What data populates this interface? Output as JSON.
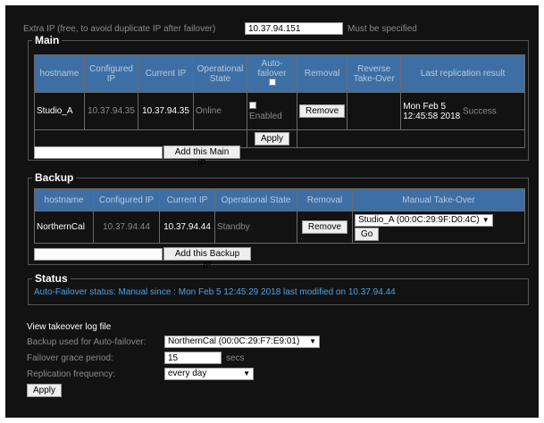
{
  "extra_ip": {
    "label": "Extra IP (free, to avoid duplicate IP after failover)",
    "value": "10.37.94.151",
    "note": "Must be specified"
  },
  "main": {
    "legend": "Main",
    "headers": [
      "hostname",
      "Configured IP",
      "Current IP",
      "Operational State",
      "Auto-failover",
      "Removal",
      "Reverse Take-Over",
      "Last replication result"
    ],
    "row": {
      "hostname": "Studio_A",
      "configured_ip": "10.37.94.35",
      "current_ip": "10.37.94.35",
      "state": "Online",
      "auto_failover": "Enabled",
      "remove_label": "Remove",
      "last_date": "Mon Feb 5",
      "last_time": "12:45:58 2018",
      "last_result": "Success"
    },
    "apply_label": "Apply",
    "add_label": "Add this Main IP",
    "add_value": ""
  },
  "backup": {
    "legend": "Backup",
    "headers": [
      "hostname",
      "Configured IP",
      "Current IP",
      "Operational State",
      "Removal",
      "Manual Take-Over"
    ],
    "row": {
      "hostname": "NorthernCal",
      "configured_ip": "10.37.94.44",
      "current_ip": "10.37.94.44",
      "state": "Standby",
      "remove_label": "Remove",
      "takeover_select": "Studio_A (00:0C:29:9F:D0:4C)",
      "go_label": "Go"
    },
    "add_label": "Add this Backup IP",
    "add_value": ""
  },
  "status": {
    "legend": "Status",
    "text": "Auto-Failover status: Manual since : Mon Feb 5 12:45:29 2018 last modified on 10.37.94.44"
  },
  "settings": {
    "log_link": "View takeover log file",
    "backup_label": "Backup used for Auto-failover:",
    "backup_value": "NorthernCal (00:0C:29:F7:E9:01)",
    "grace_label": "Failover grace period:",
    "grace_value": "15",
    "grace_unit": "secs",
    "freq_label": "Replication frequency:",
    "freq_value": "every day",
    "apply_label": "Apply"
  },
  "colors": {
    "panel_bg": "#121212",
    "header_bg": "#3d6fa5",
    "status_text": "#4aa3e6"
  }
}
